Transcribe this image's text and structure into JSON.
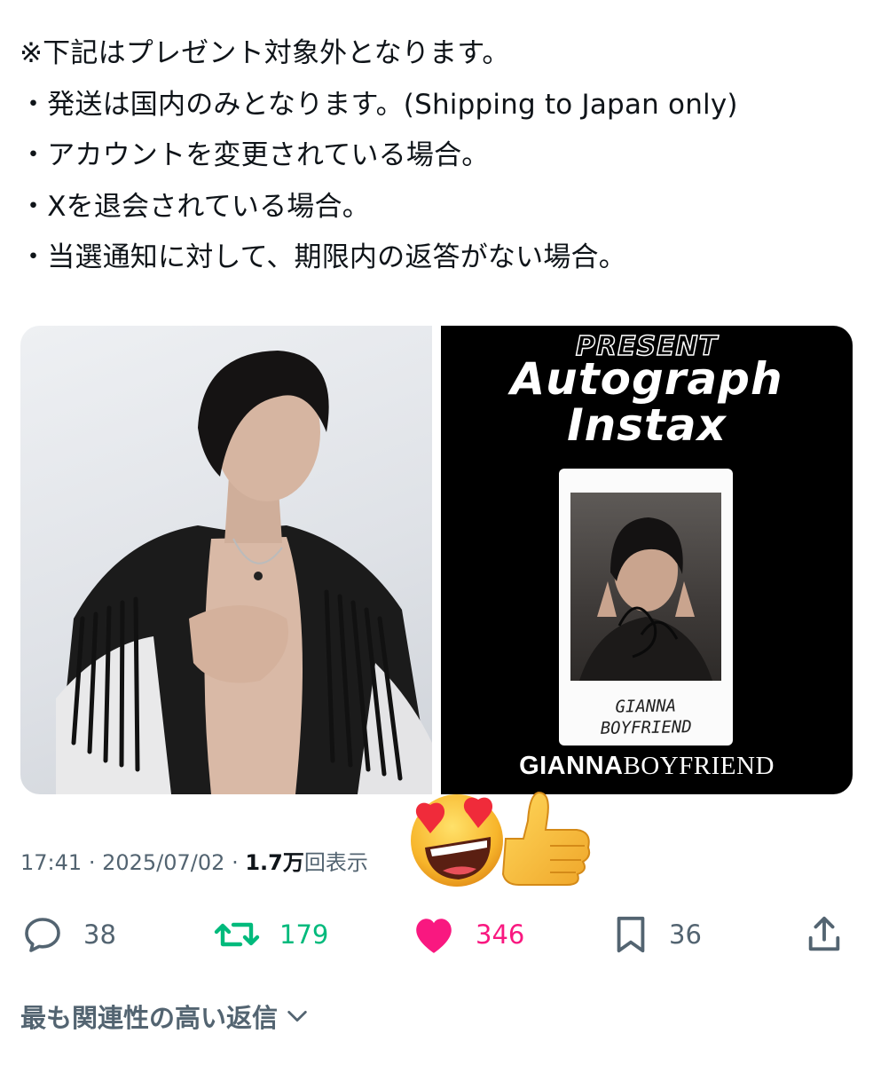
{
  "tweet": {
    "lines": [
      "※下記はプレゼント対象外となります。",
      "・発送は国内のみとなります。(Shipping to Japan only)",
      "・アカウントを変更されている場合。",
      "・Xを退会されている場合。",
      "・当選通知に対して、期限内の返答がない場合。"
    ]
  },
  "media": {
    "present_label": "PRESENT",
    "title_line1": "Autograph",
    "title_line2": "Instax",
    "polaroid_caption_line1": "GIANNA",
    "polaroid_caption_line2": "BOYFRIEND",
    "brand_bold": "GIANNA",
    "brand_serif": "BOYFRIEND"
  },
  "meta": {
    "time": "17:41",
    "separator": "·",
    "date": "2025/07/02",
    "views_count": "1.7万",
    "views_label": "回表示"
  },
  "actions": {
    "replies": "38",
    "reposts": "179",
    "likes": "346",
    "bookmarks": "36"
  },
  "replies_sort": {
    "label": "最も関連性の高い返信"
  },
  "colors": {
    "text": "#0f1419",
    "muted": "#536471",
    "repost_active": "#00ba7c",
    "like_active": "#f91880"
  },
  "icons": {
    "reply": "reply-icon",
    "repost": "repost-icon",
    "like": "heart-icon",
    "bookmark": "bookmark-icon",
    "share": "share-icon",
    "chevron": "chevron-down-icon",
    "sticker": "heart-eyes-thumbs-up-emoji"
  }
}
